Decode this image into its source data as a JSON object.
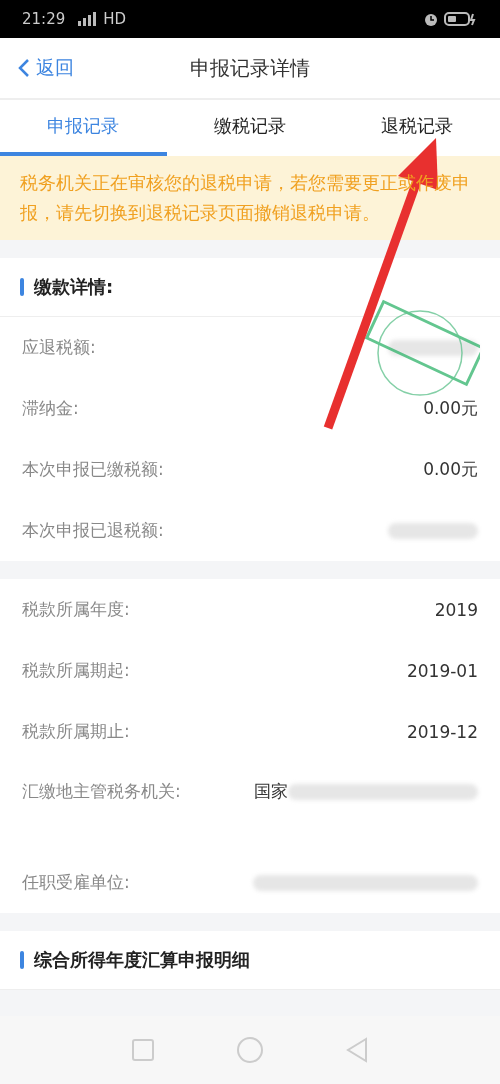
{
  "status_bar": {
    "time": "21:29",
    "network": "HD"
  },
  "nav": {
    "back": "返回",
    "title": "申报记录详情"
  },
  "tabs": [
    {
      "label": "申报记录",
      "selected": true
    },
    {
      "label": "缴税记录",
      "selected": false
    },
    {
      "label": "退税记录",
      "selected": false
    }
  ],
  "notice": "税务机关正在审核您的退税申请，若您需要更正或作废申报，请先切换到退税记录页面撤销退税申请。",
  "sections": [
    {
      "title": "缴款详情:",
      "stamp": true,
      "rows": [
        {
          "label": "应退税额:",
          "value": "",
          "blurred": true
        },
        {
          "label": "滞纳金:",
          "value": "0.00元",
          "blurred": false
        },
        {
          "label": "本次申报已缴税额:",
          "value": "0.00元",
          "blurred": false
        },
        {
          "label": "本次申报已退税额:",
          "value": "",
          "blurred": true
        }
      ]
    },
    {
      "stamp": false,
      "rows": [
        {
          "label": "税款所属年度:",
          "value": "2019",
          "blurred": false
        },
        {
          "label": "税款所属期起:",
          "value": "2019-01",
          "blurred": false
        },
        {
          "label": "税款所属期止:",
          "value": "2019-12",
          "blurred": false
        },
        {
          "label": "汇缴地主管税务机关:",
          "value": "国家",
          "blurred": true,
          "tall": true
        },
        {
          "label": "任职受雇单位:",
          "value": "",
          "blurred": true
        }
      ]
    },
    {
      "title": "综合所得年度汇算申报明细",
      "stamp": false
    }
  ],
  "annotation": {
    "kind": "arrow"
  }
}
